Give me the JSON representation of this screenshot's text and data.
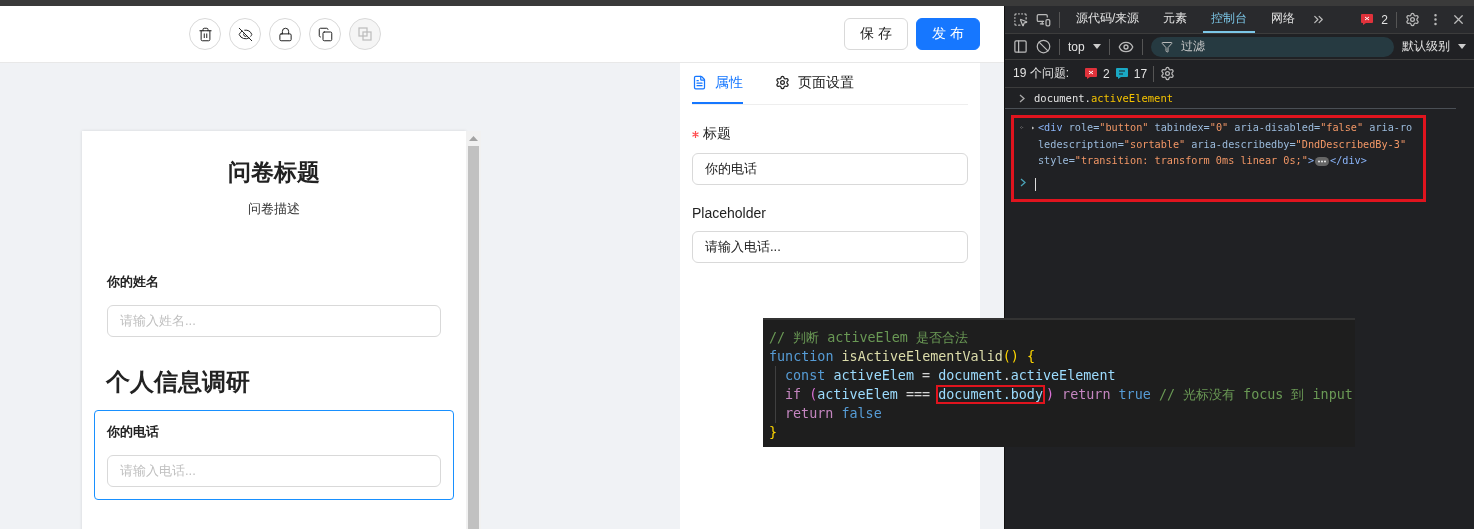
{
  "toolbar": {
    "tools": [
      {
        "kind": "delete",
        "disabled": false
      },
      {
        "kind": "hide",
        "disabled": false
      },
      {
        "kind": "lock",
        "disabled": false
      },
      {
        "kind": "copy",
        "disabled": false
      },
      {
        "kind": "paste",
        "disabled": true
      }
    ],
    "actions": [
      {
        "label": "保 存",
        "kind": "default"
      },
      {
        "label": "发 布",
        "kind": "primary"
      }
    ]
  },
  "survey": {
    "title": "问卷标题",
    "description": "问卷描述",
    "components": [
      {
        "kind": "input",
        "title": "你的姓名",
        "placeholder": "请输入姓名...",
        "selected": false
      },
      {
        "kind": "heading",
        "text": "个人信息调研"
      },
      {
        "kind": "input",
        "title": "你的电话",
        "placeholder": "请输入电话...",
        "selected": true
      }
    ]
  },
  "props_panel": {
    "tabs": [
      {
        "label": "属性",
        "kind": "file",
        "selected": true
      },
      {
        "label": "页面设置",
        "kind": "gear",
        "selected": false
      }
    ],
    "fields": [
      {
        "label": "标题",
        "required": true,
        "value": "你的电话"
      },
      {
        "label": "Placeholder",
        "required": false,
        "value": "请输入电话..."
      }
    ]
  },
  "devtools": {
    "tabs": [
      {
        "label": "源代码/来源",
        "selected": false
      },
      {
        "label": "元素",
        "selected": false
      },
      {
        "label": "控制台",
        "selected": true
      },
      {
        "label": "网络",
        "selected": false
      }
    ],
    "error_badge": "2",
    "context": "top",
    "filter_placeholder": "过滤",
    "level_select": "默认级别",
    "issues": {
      "label": "19 个问题:",
      "errors": "2",
      "infos": "17"
    },
    "console_input": [
      {
        "kind": "plain",
        "text": "document."
      },
      {
        "kind": "prop",
        "text": "activeElement"
      }
    ],
    "console_output": {
      "highlighted": true,
      "tokens": [
        {
          "kind": "tag",
          "text": "<div"
        },
        {
          "kind": "attr",
          "text": " role="
        },
        {
          "kind": "value",
          "text": "\"button\""
        },
        {
          "kind": "attr",
          "text": " tabindex="
        },
        {
          "kind": "value",
          "text": "\"0\""
        },
        {
          "kind": "attr",
          "text": " aria-disabled="
        },
        {
          "kind": "value",
          "text": "\"false\""
        },
        {
          "kind": "attr",
          "text": " aria-roledescription="
        },
        {
          "kind": "value",
          "text": "\"sortable\""
        },
        {
          "kind": "attr",
          "text": " aria-describedby="
        },
        {
          "kind": "value",
          "text": "\"DndDescribedBy-3\""
        },
        {
          "kind": "attr",
          "text": " style="
        },
        {
          "kind": "value",
          "text": "\"transition: transform 0ms linear 0s;\""
        },
        {
          "kind": "tag",
          "text": ">"
        },
        {
          "kind": "ellipsis"
        },
        {
          "kind": "tag",
          "text": "</div>"
        }
      ]
    }
  },
  "code_snippet": {
    "lines": [
      {
        "indent": false,
        "tokens": [
          {
            "kind": "comment",
            "text": "// 判断 activeElem 是否合法"
          }
        ]
      },
      {
        "indent": false,
        "tokens": [
          {
            "kind": "keyword",
            "text": "function "
          },
          {
            "kind": "func",
            "text": "isActiveElementValid"
          },
          {
            "kind": "brace",
            "text": "() {"
          }
        ]
      },
      {
        "indent": true,
        "tokens": [
          {
            "kind": "keyword",
            "text": "const "
          },
          {
            "kind": "var",
            "text": "activeElem"
          },
          {
            "kind": "plain",
            "text": " = "
          },
          {
            "kind": "var",
            "text": "document"
          },
          {
            "kind": "plain",
            "text": "."
          },
          {
            "kind": "var",
            "text": "activeElement"
          }
        ]
      },
      {
        "indent": true,
        "tokens": [
          {
            "kind": "control",
            "text": "if "
          },
          {
            "kind": "paren",
            "text": "("
          },
          {
            "kind": "var",
            "text": "activeElem"
          },
          {
            "kind": "plain",
            "text": " === "
          },
          {
            "kind": "var",
            "text": "document.body",
            "boxed": true
          },
          {
            "kind": "paren",
            "text": ")"
          },
          {
            "kind": "control",
            "text": " return "
          },
          {
            "kind": "keyword",
            "text": "true "
          },
          {
            "kind": "comment",
            "text": "// 光标没有 focus 到 input"
          }
        ]
      },
      {
        "indent": true,
        "tokens": [
          {
            "kind": "control",
            "text": "return "
          },
          {
            "kind": "keyword",
            "text": "false"
          }
        ]
      },
      {
        "indent": false,
        "tokens": [
          {
            "kind": "brace",
            "text": "}"
          }
        ]
      }
    ]
  }
}
